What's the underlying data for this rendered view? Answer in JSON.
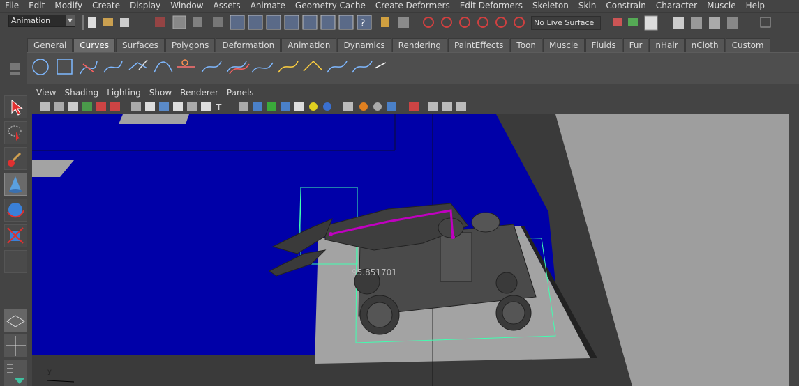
{
  "menubar": [
    "File",
    "Edit",
    "Modify",
    "Create",
    "Display",
    "Window",
    "Assets",
    "Animate",
    "Geometry Cache",
    "Create Deformers",
    "Edit Deformers",
    "Skeleton",
    "Skin",
    "Constrain",
    "Character",
    "Muscle",
    "Help"
  ],
  "statusline": {
    "mode": "Animation",
    "live_surface": "No Live Surface"
  },
  "shelf": {
    "tabs": [
      "General",
      "Curves",
      "Surfaces",
      "Polygons",
      "Deformation",
      "Animation",
      "Dynamics",
      "Rendering",
      "PaintEffects",
      "Toon",
      "Muscle",
      "Fluids",
      "Fur",
      "nHair",
      "nCloth",
      "Custom"
    ],
    "active_tab": "Curves",
    "icons": [
      "circle-icon",
      "square-icon",
      "cv-curve-icon",
      "ep-curve-icon",
      "pencil-curve-icon",
      "arc-icon",
      "cut-curve-icon",
      "attach-curve-icon",
      "offset-curve-icon",
      "rebuild-curve-icon",
      "fillet-icon",
      "insert-knot-icon",
      "extend-icon",
      "smooth-curve-icon",
      "edit-curve-tool-icon"
    ]
  },
  "panel": {
    "menus": [
      "View",
      "Shading",
      "Lighting",
      "Show",
      "Renderer",
      "Panels"
    ]
  },
  "viewport": {
    "heads_up_value": "95.851701",
    "colors": {
      "ground_blue": "#0000a8",
      "floor_grey": "#a3a3a3",
      "border_dark": "#3a3a3a",
      "selection_green": "#40ffb0",
      "joint_magenta": "#c000c0"
    }
  },
  "colors": {
    "ui_bg": "#444444",
    "active_tab": "#6a6a6a"
  }
}
